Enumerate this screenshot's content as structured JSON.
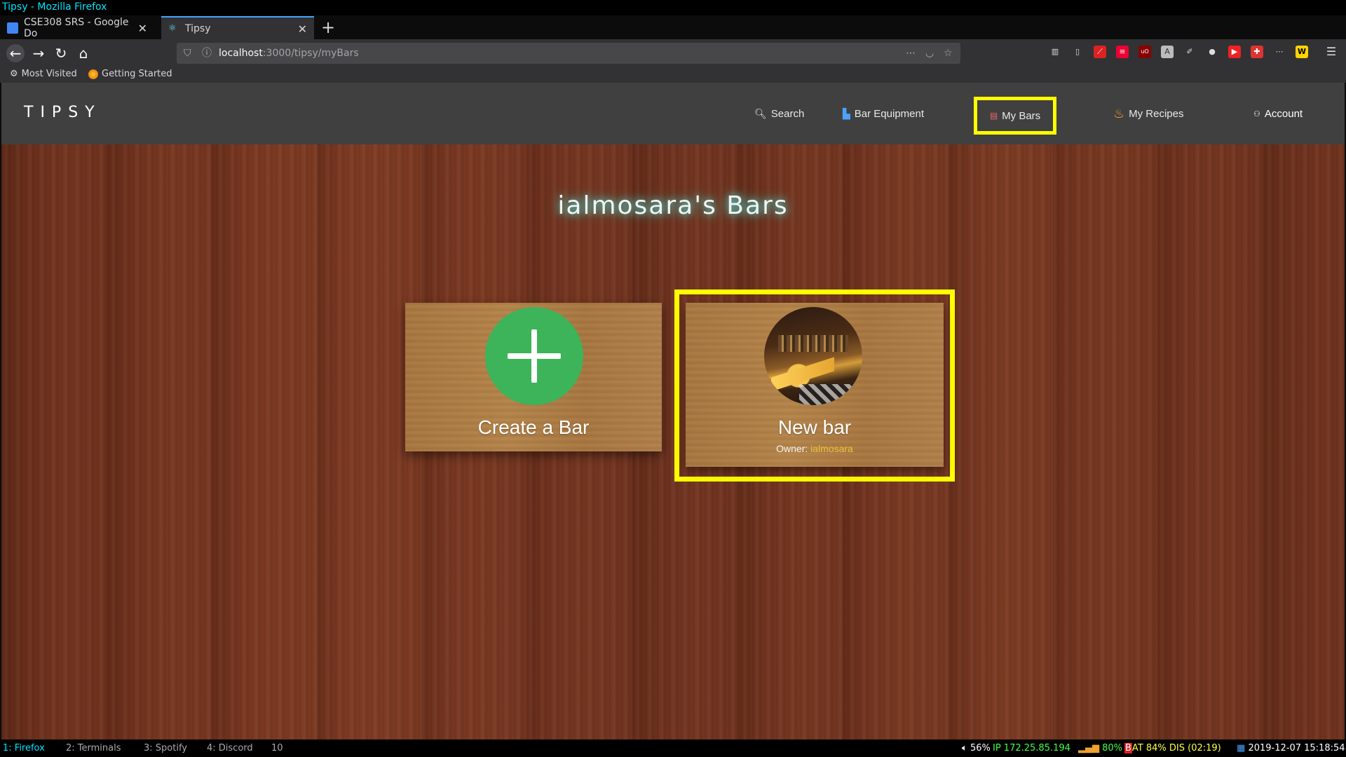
{
  "window": {
    "title": "Tipsy - Mozilla Firefox"
  },
  "browser": {
    "tabs": [
      {
        "label": "CSE308 SRS - Google Do"
      },
      {
        "label": "Tipsy"
      }
    ],
    "url_host": "localhost",
    "url_path": ":3000/tipsy/myBars",
    "bookmarks": [
      {
        "label": "Most Visited"
      },
      {
        "label": "Getting Started"
      }
    ]
  },
  "site": {
    "logo": "TIPSY",
    "nav": {
      "search": "Search",
      "equipment": "Bar Equipment",
      "mybars": "My Bars",
      "recipes": "My Recipes",
      "account": "Account"
    },
    "page_title": "ialmosara's Bars",
    "cards": {
      "create": {
        "title": "Create a Bar"
      },
      "bar": {
        "title": "New bar",
        "owner_label": "Owner:",
        "owner_name": "ialmosara"
      }
    }
  },
  "statusbar": {
    "workspaces": [
      {
        "label": "1: Firefox",
        "color": "#00e5ff"
      },
      {
        "label": "2: Terminals"
      },
      {
        "label": "3: Spotify"
      },
      {
        "label": "4: Discord"
      },
      {
        "label": "10"
      }
    ],
    "volume": "56%",
    "ip": "IP 172.25.85.194",
    "wifi": "80%",
    "battery": "AT 84% DIS (02:19)",
    "datetime": "2019-12-07 15:18:54"
  },
  "colors": {
    "highlight": "#ffff00",
    "plus_circle": "#3db35a",
    "owner_accent": "#e8c23d"
  }
}
